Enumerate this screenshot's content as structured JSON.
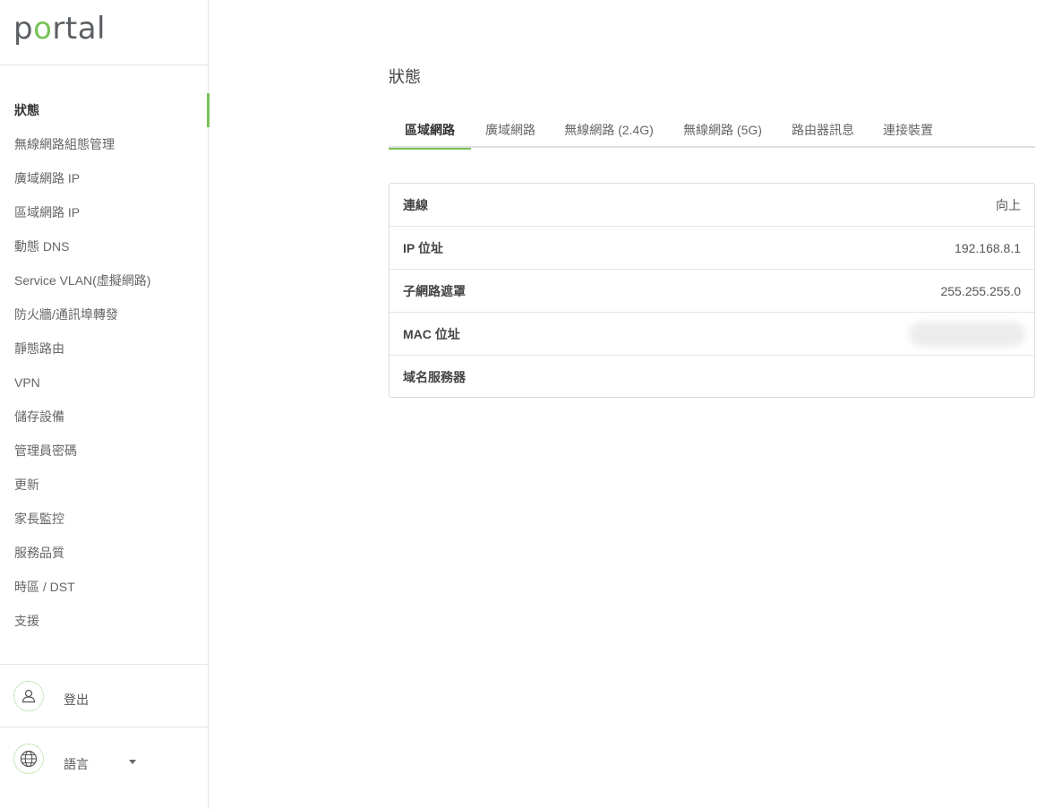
{
  "brand": {
    "logo_prefix": "p",
    "logo_o": "o",
    "logo_suffix": "rtal"
  },
  "sidebar": {
    "items": [
      {
        "label": "狀態",
        "active": true
      },
      {
        "label": "無線網路組態管理"
      },
      {
        "label": "廣域網路 IP"
      },
      {
        "label": "區域網路 IP"
      },
      {
        "label": "動態 DNS"
      },
      {
        "label": "Service VLAN(虛擬網路)"
      },
      {
        "label": "防火牆/通訊埠轉發"
      },
      {
        "label": "靜態路由"
      },
      {
        "label": "VPN"
      },
      {
        "label": "儲存設備"
      },
      {
        "label": "管理員密碼"
      },
      {
        "label": "更新"
      },
      {
        "label": "家長監控"
      },
      {
        "label": "服務品質"
      },
      {
        "label": "時區 / DST"
      },
      {
        "label": "支援"
      }
    ],
    "logout": {
      "label": "登出",
      "icon": "user-icon"
    },
    "language": {
      "label": "語言",
      "icon": "globe-icon"
    }
  },
  "main": {
    "title": "狀態",
    "tabs": [
      {
        "label": "區域網路",
        "active": true
      },
      {
        "label": "廣域網路"
      },
      {
        "label": "無線網路 (2.4G)"
      },
      {
        "label": "無線網路 (5G)"
      },
      {
        "label": "路由器訊息"
      },
      {
        "label": "連接裝置"
      }
    ],
    "rows": [
      {
        "label": "連線",
        "value": "向上"
      },
      {
        "label": "IP 位址",
        "value": "192.168.8.1"
      },
      {
        "label": "子網路遮罩",
        "value": "255.255.255.0"
      },
      {
        "label": "MAC 位址",
        "value": ""
      },
      {
        "label": "域名服務器",
        "value": ""
      }
    ]
  },
  "colors": {
    "accent": "#78c257",
    "text": "#555555",
    "border": "#e4e4e4"
  }
}
